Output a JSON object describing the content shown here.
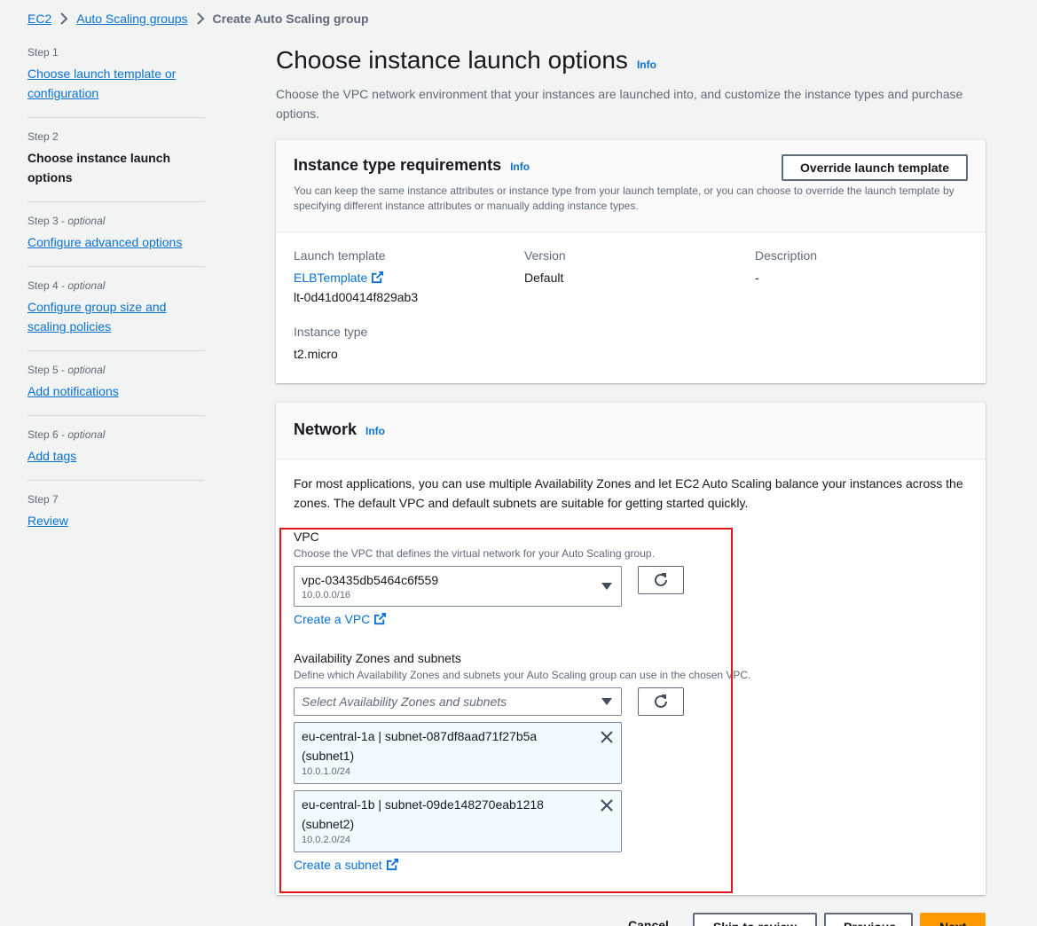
{
  "breadcrumb": {
    "items": [
      "EC2",
      "Auto Scaling groups"
    ],
    "current": "Create Auto Scaling group"
  },
  "steps": [
    {
      "num": "Step 1",
      "optional": "",
      "title": "Choose launch template or configuration"
    },
    {
      "num": "Step 2",
      "optional": "",
      "title": "Choose instance launch options"
    },
    {
      "num": "Step 3",
      "optional": "optional",
      "title": "Configure advanced options"
    },
    {
      "num": "Step 4",
      "optional": "optional",
      "title": "Configure group size and scaling policies"
    },
    {
      "num": "Step 5",
      "optional": "optional",
      "title": "Add notifications"
    },
    {
      "num": "Step 6",
      "optional": "optional",
      "title": "Add tags"
    },
    {
      "num": "Step 7",
      "optional": "",
      "title": "Review"
    }
  ],
  "page": {
    "title": "Choose instance launch options",
    "info": "Info",
    "description": "Choose the VPC network environment that your instances are launched into, and customize the instance types and purchase options."
  },
  "instance_req": {
    "title": "Instance type requirements",
    "info": "Info",
    "override_button": "Override launch template",
    "description": "You can keep the same instance attributes or instance type from your launch template, or you can choose to override the launch template by specifying different instance attributes or manually adding instance types.",
    "launch_template_label": "Launch template",
    "launch_template_name": "ELBTemplate",
    "launch_template_id": "lt-0d41d00414f829ab3",
    "version_label": "Version",
    "version_value": "Default",
    "description_label": "Description",
    "description_value": "-",
    "instance_type_label": "Instance type",
    "instance_type_value": "t2.micro"
  },
  "network": {
    "title": "Network",
    "info": "Info",
    "intro": "For most applications, you can use multiple Availability Zones and let EC2 Auto Scaling balance your instances across the zones. The default VPC and default subnets are suitable for getting started quickly.",
    "vpc_label": "VPC",
    "vpc_desc": "Choose the VPC that defines the virtual network for your Auto Scaling group.",
    "vpc_value": "vpc-03435db5464c6f559",
    "vpc_cidr": "10.0.0.0/16",
    "create_vpc": "Create a VPC",
    "az_label": "Availability Zones and subnets",
    "az_desc": "Define which Availability Zones and subnets your Auto Scaling group can use in the chosen VPC.",
    "az_placeholder": "Select Availability Zones and subnets",
    "subnets": [
      {
        "main": "eu-central-1a | subnet-087df8aad71f27b5a (subnet1)",
        "cidr": "10.0.1.0/24"
      },
      {
        "main": "eu-central-1b | subnet-09de148270eab1218 (subnet2)",
        "cidr": "10.0.2.0/24"
      }
    ],
    "create_subnet": "Create a subnet"
  },
  "footer": {
    "cancel": "Cancel",
    "skip": "Skip to review",
    "previous": "Previous",
    "next": "Next"
  },
  "colors": {
    "link": "#0972d3",
    "highlight": "#e4151b",
    "primary_button": "#ff9900"
  }
}
